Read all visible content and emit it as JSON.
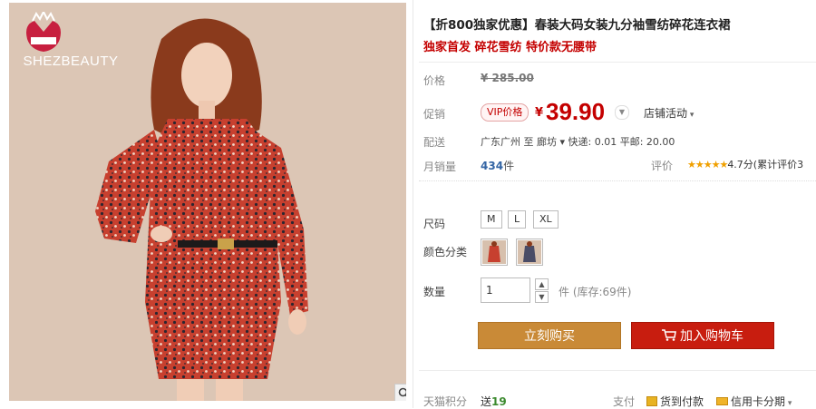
{
  "product": {
    "title": "【折800独家优惠】春装大码女装九分袖雪纺碎花连衣裙",
    "subtitle": "独家首发 碎花雪纺 特价款无腰带",
    "brand_logo_text": "SHEZBEAUTY"
  },
  "price": {
    "label": "价格",
    "original": "¥ 285.00",
    "promo_label": "促销",
    "vip_badge": "VIP价格",
    "currency": "¥",
    "value": "39.90",
    "store_activity": "店铺活动"
  },
  "shipping": {
    "label": "配送",
    "text": "广东广州 至  廊坊 ▾ 快递: 0.01 平邮: 20.00"
  },
  "sales": {
    "label": "月销量",
    "count": "434",
    "unit": "件",
    "rating_label": "评价",
    "stars": "★★★★★",
    "rating_text": "4.7分(累计评价3"
  },
  "size": {
    "label": "尺码",
    "options": [
      "M",
      "L",
      "XL"
    ]
  },
  "color": {
    "label": "颜色分类"
  },
  "quantity": {
    "label": "数量",
    "value": "1",
    "stock": "件 (库存:69件)"
  },
  "actions": {
    "buy_now": "立刻购买",
    "add_to_cart": "加入购物车"
  },
  "footer": {
    "points_label": "天猫积分",
    "points_prefix": "送",
    "points_value": "19",
    "pay_label": "支付",
    "cod": "货到付款",
    "card": "信用卡分期"
  },
  "colors": {
    "accent_red": "#c40000",
    "buy_button": "#c98a37",
    "cart_button": "#c81d0f"
  },
  "icons": {
    "zoom": "magnifier-icon",
    "cart": "shopping-cart-icon"
  }
}
